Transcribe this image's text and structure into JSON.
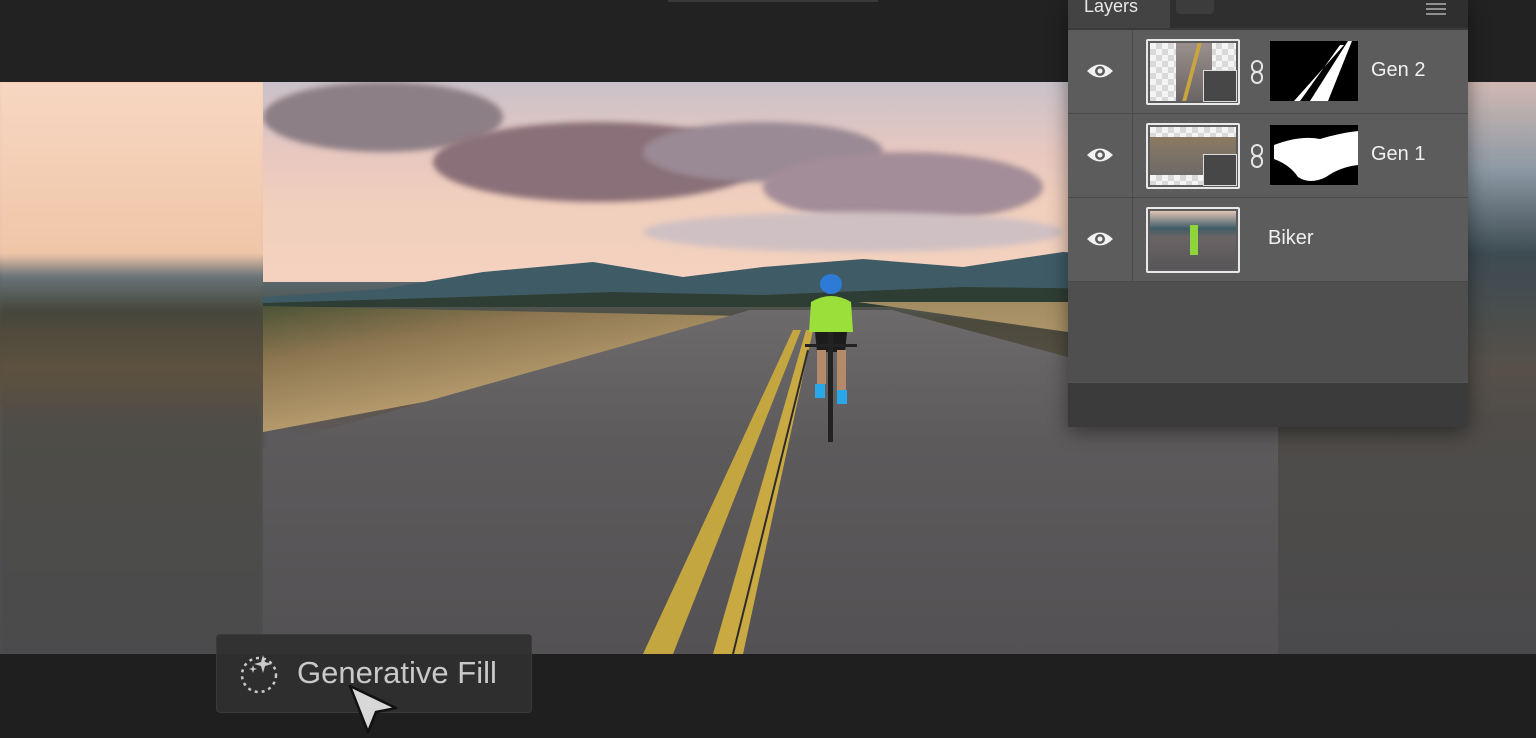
{
  "layers_panel": {
    "tab_label": "Layers",
    "layers": [
      {
        "name": "Gen 2",
        "visible": true,
        "icon": "eye-icon",
        "has_mask": true
      },
      {
        "name": "Gen 1",
        "visible": true,
        "icon": "eye-icon",
        "has_mask": true
      },
      {
        "name": "Biker",
        "visible": true,
        "icon": "eye-icon",
        "has_mask": false
      }
    ]
  },
  "toolbar": {
    "generative_fill_label": "Generative Fill",
    "generative_fill_icon": "sparkle-icon"
  },
  "colors": {
    "app_background": "#1e1e1e",
    "panel_background": "#3a3a3a",
    "layer_row": "#5c5c5c"
  }
}
